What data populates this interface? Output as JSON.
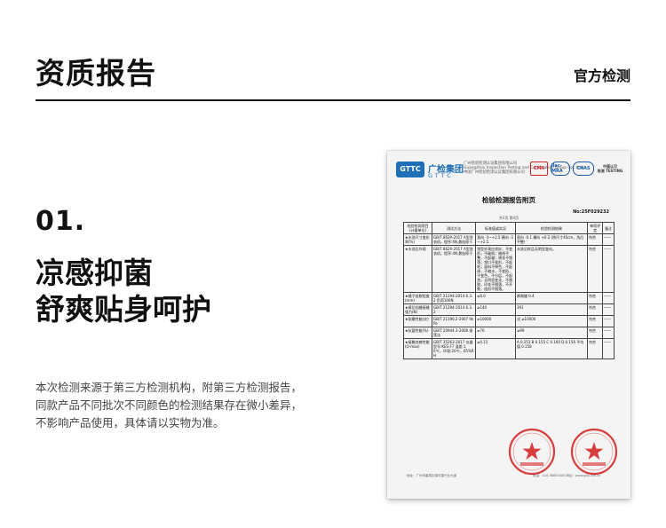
{
  "header": {
    "title": "资质报告",
    "right_label": "官方检测"
  },
  "section": {
    "number": "01.",
    "headline_1": "凉感抑菌",
    "headline_2": "舒爽贴身呵护",
    "body_lines": [
      "本次检测来源于第三方检测机构，附第三方检测报告，",
      "同款产品不同批次不同颜色的检测结果存在微小差异，",
      "不影响产品使用，具体请以实物为准。"
    ]
  },
  "document": {
    "logo_mark": "GTTC",
    "logo_cn": "广检集团",
    "logo_en": "GTTC",
    "org_lines": [
      "广州检验检测认证集团有限公司",
      "Guangzhou Inspection Testing and Certification Group Co., Ltd.",
      "中国广州检验检测认证集团有限公司"
    ],
    "marks": {
      "cma": "CMA",
      "ilac": "ilac-MRA",
      "cnas": "CNAS",
      "cn_top": "中国认可",
      "cn_bottom": "检测 TESTING"
    },
    "title": "检验检测报告附页",
    "report_no": "No:25F029232",
    "page_info": "共3页 第4页",
    "table_headers": [
      "检验检测项目(计量单位)",
      "测试方法",
      "标准值或实况",
      "检验检测结果",
      "单项评定",
      "备注"
    ],
    "rows": [
      {
        "item": "★水洗尺寸变化率(%)",
        "method": "GB/T 8629-2017 A型洗衣机，程序:4N,悬挂晾干",
        "standard": "直向 -3~+2.5 横向 -3~+2.5",
        "result": "直向 -0.1 横向 +0.2 (原尺寸40cm，洗后平整)",
        "judge": "符合",
        "note": "——"
      },
      {
        "item": "★水洗后外观",
        "method": "GB/T 8629-2017 A型洗衣机，程序:4N,悬挂晾干",
        "standard": "领型外观应良好，不变形，不破损；缝线平整，不起皱；绣花不脱落；领口不变形，不起毛；面料不掉色，不起球，不缩水，不变形，不变色，不分层，不起泡，无明显变化，不脱胶，印花不脱落，不开裂，纽扣不脱落。",
        "result": "水洗后样品无明显变化。",
        "judge": "符合",
        "note": "——"
      },
      {
        "item": "★缝子纰裂程度(mm)",
        "method": "GB/T 21294-2014 6.3.2 负荷100N",
        "standard": "≤6.0",
        "result": "裤侧缝 0.4",
        "judge": "符合",
        "note": "——"
      },
      {
        "item": "★裤后裆缝接缝强力(N)",
        "method": "GB/T 21294-2014 6.3.2",
        "standard": "≥140",
        "result": "391",
        "judge": "符合",
        "note": "——"
      },
      {
        "item": "★耐磨性能(次)",
        "method": "GB/T 21196.2-2007 9kPa",
        "standard": "≥10000",
        "result": "试 ≥10000",
        "judge": "符合",
        "note": "——"
      },
      {
        "item": "★抗菌性能(%)",
        "method": "GB/T 20944.3-2008 振荡法",
        "standard": "≥70",
        "result": "≥99",
        "judge": "符合",
        "note": "——"
      },
      {
        "item": "★接触凉感性能(Q-max)",
        "method": "GB/T 35263-2017 仪器型号:KES-F7 温差:10℃，环境:20℃，65%RH",
        "standard": "≥0.15",
        "result": "A 0.151 B 0.155 C 0.160 D 0.156 平均值 0.158",
        "judge": "符合",
        "note": "——"
      }
    ],
    "stamp_1_text": "广州检验检测认证集团有限公司 检验检测专用章",
    "stamp_2_text": "广州检验检测认证集团有限公司 检验检测专用章",
    "footer_left": "地址：广州市番禺区南村镇兴业大道",
    "footer_right": "电话：020-38800000 网址：www.gttc.net.cn"
  }
}
